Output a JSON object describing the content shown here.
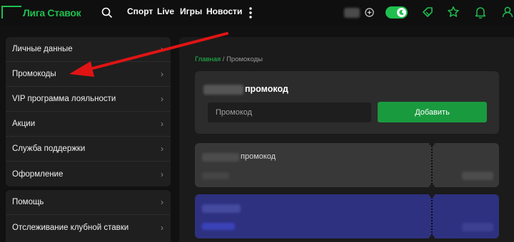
{
  "header": {
    "logo_text": "Лига Ставок",
    "nav": [
      "Спорт",
      "Live",
      "Игры",
      "Новости"
    ],
    "icons": [
      "search-icon",
      "more-vertical-icon",
      "plus-circle-icon",
      "moon-icon",
      "coupon-icon",
      "star-icon",
      "bell-icon",
      "user-icon"
    ],
    "toggle_on": true,
    "accent_color": "#1fbf4f"
  },
  "sidebar": {
    "group1": [
      {
        "label": "Личные данные"
      },
      {
        "label": "Промокоды"
      },
      {
        "label": "VIP программа лояльности"
      },
      {
        "label": "Акции"
      },
      {
        "label": "Служба поддержки"
      },
      {
        "label": "Оформление"
      }
    ],
    "group2": [
      {
        "label": "Помощь"
      },
      {
        "label": "Отслеживание клубной ставки"
      }
    ],
    "chevron": "›"
  },
  "main": {
    "breadcrumb": {
      "home": "Главная",
      "sep": " / ",
      "current": "Промокоды"
    },
    "promo_title": "промокод",
    "promo_placeholder": "Промокод",
    "add_button": "Добавить",
    "ticket_label": "промокод"
  },
  "colors": {
    "button_green": "#1a9a3e",
    "ticket_blue": "#2e3180",
    "arrow_red": "#e01414"
  }
}
